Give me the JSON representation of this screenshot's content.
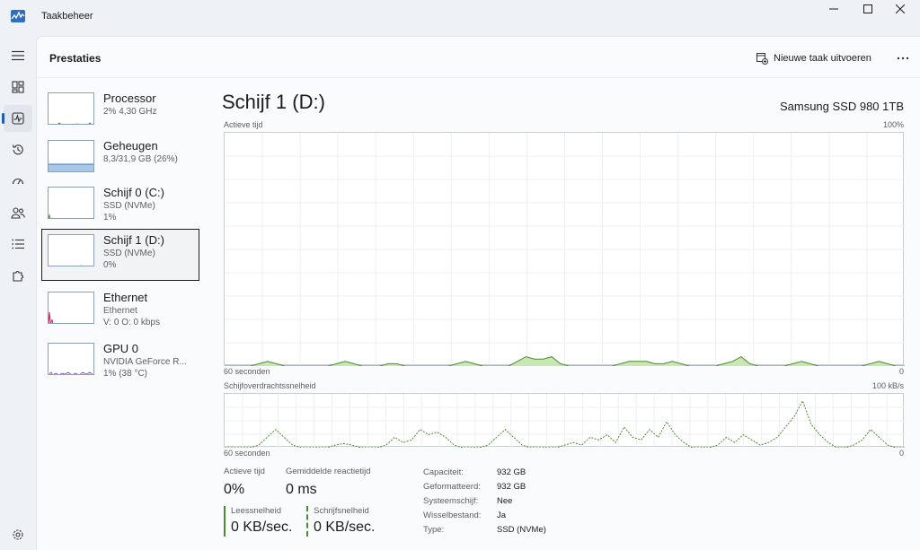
{
  "window": {
    "title": "Taakbeheer"
  },
  "page": {
    "title": "Prestaties",
    "run_task_label": "Nieuwe taak uitvoeren"
  },
  "resources": [
    {
      "name": "Processor",
      "sub1": "2% 4,30 GHz",
      "sub2": ""
    },
    {
      "name": "Geheugen",
      "sub1": "8,3/31,9 GB (26%)",
      "sub2": ""
    },
    {
      "name": "Schijf 0 (C:)",
      "sub1": "SSD (NVMe)",
      "sub2": "1%"
    },
    {
      "name": "Schijf 1 (D:)",
      "sub1": "SSD (NVMe)",
      "sub2": "0%"
    },
    {
      "name": "Ethernet",
      "sub1": "Ethernet",
      "sub2": "V: 0 O: 0 kbps"
    },
    {
      "name": "GPU 0",
      "sub1": "NVIDIA GeForce R...",
      "sub2": "1% (38 °C)"
    }
  ],
  "detail": {
    "title": "Schijf 1 (D:)",
    "model": "Samsung SSD 980 1TB",
    "graph1": {
      "label": "Actieve tijd",
      "max": "100%",
      "time": "60 seconden",
      "min": "0"
    },
    "graph2": {
      "label": "Schijfoverdrachtssnelheid",
      "max": "100 kB/s",
      "time": "60 seconden",
      "min": "0"
    },
    "stats": {
      "active_label": "Actieve tijd",
      "active_value": "0%",
      "latency_label": "Gemiddelde reactietijd",
      "latency_value": "0 ms",
      "read_label": "Leessnelheid",
      "read_value": "0 KB/sec.",
      "write_label": "Schrijfsnelheid",
      "write_value": "0 KB/sec."
    },
    "properties": [
      {
        "key": "Capaciteit:",
        "value": "932 GB"
      },
      {
        "key": "Geformatteerd:",
        "value": "932 GB"
      },
      {
        "key": "Systeemschijf:",
        "value": "Nee"
      },
      {
        "key": "Wisselbestand:",
        "value": "Ja"
      },
      {
        "key": "Type:",
        "value": "SSD (NVMe)"
      }
    ]
  },
  "colors": {
    "accent": "#1b5fb5",
    "disk_line": "#4b8a2e",
    "disk_fill": "#c9e7b2",
    "memory_fill": "#a9c8e8",
    "ethernet_line": "#c2185b",
    "gpu_line": "#7b4fc9"
  },
  "chart_data": [
    {
      "type": "area",
      "title": "Actieve tijd",
      "ylim": [
        0,
        100
      ],
      "xlabel": "60 seconden",
      "values": [
        0,
        0,
        0,
        0,
        1,
        2,
        1,
        0,
        0,
        0,
        0,
        0,
        0,
        1,
        2,
        1,
        0,
        0,
        0,
        1,
        1,
        0,
        0,
        0,
        0,
        0,
        0,
        1,
        2,
        1,
        0,
        0,
        0,
        0,
        2,
        4,
        3,
        3,
        4,
        1,
        0,
        0,
        0,
        0,
        0,
        0,
        1,
        2,
        2,
        2,
        1,
        1,
        2,
        1,
        0,
        0,
        0,
        0,
        1,
        2,
        4,
        1,
        0,
        0,
        0,
        0,
        1,
        2,
        1,
        0,
        0,
        0,
        0,
        0,
        0,
        1,
        2,
        1,
        0,
        0
      ]
    },
    {
      "type": "line",
      "title": "Schijfoverdrachtssnelheid",
      "ylim": [
        0,
        100
      ],
      "xlabel": "60 seconden",
      "values": [
        0,
        0,
        0,
        0,
        5,
        20,
        35,
        20,
        5,
        0,
        0,
        0,
        0,
        5,
        8,
        5,
        0,
        0,
        0,
        5,
        20,
        10,
        15,
        35,
        25,
        30,
        20,
        5,
        0,
        0,
        0,
        5,
        20,
        35,
        20,
        5,
        0,
        0,
        0,
        0,
        5,
        10,
        5,
        20,
        15,
        25,
        10,
        40,
        20,
        15,
        35,
        20,
        50,
        25,
        10,
        0,
        0,
        0,
        5,
        20,
        10,
        25,
        15,
        5,
        10,
        20,
        40,
        60,
        90,
        45,
        25,
        10,
        0,
        0,
        5,
        15,
        35,
        20,
        5,
        0,
        0
      ]
    }
  ]
}
